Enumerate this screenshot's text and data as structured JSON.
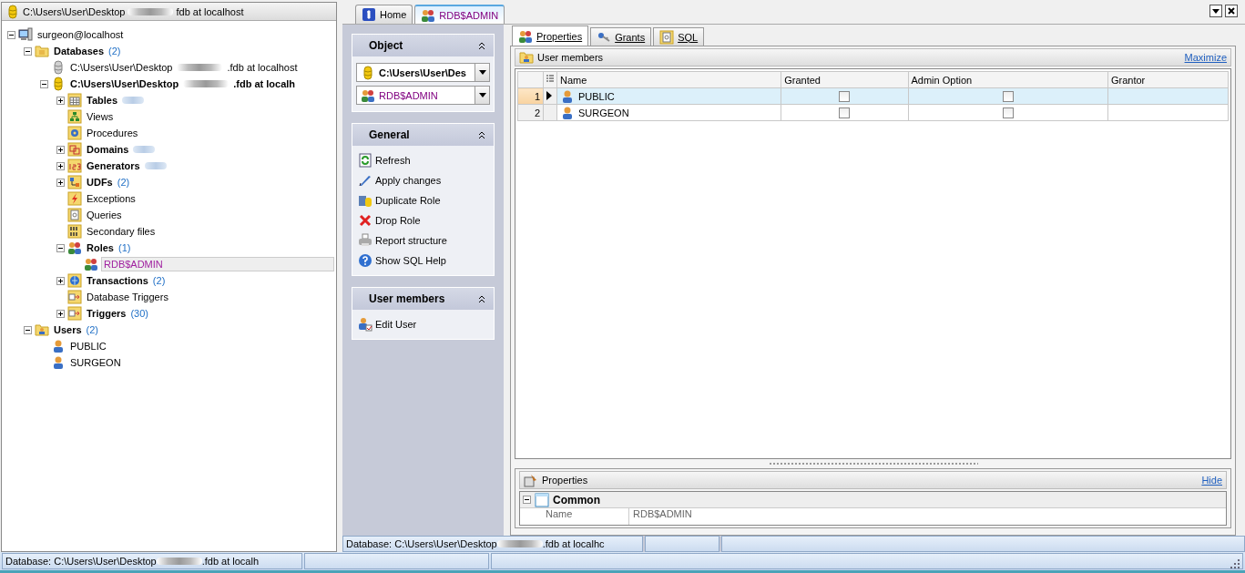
{
  "left_panel": {
    "header": {
      "path_start": "C:\\Users\\User\\Desktop",
      "path_end": "fdb at localhost",
      "redacted": true
    },
    "tree": [
      {
        "label": "surgeon@localhost",
        "kind": "server",
        "bold": false,
        "expanded": true,
        "selected": false,
        "children": [
          {
            "label": "Databases",
            "count": "(2)",
            "kind": "folder",
            "bold": true,
            "expanded": true,
            "selected": false,
            "children": [
              {
                "label": "C:\\Users\\User\\Desktop",
                "label_end": ".fdb at localhost",
                "redacted": true,
                "kind": "db-grey",
                "bold": false,
                "selected": false
              },
              {
                "label": "C:\\Users\\User\\Desktop",
                "label_end": ".fdb at localh",
                "redacted": true,
                "kind": "db",
                "bold": true,
                "expanded": true,
                "selected": false,
                "children": [
                  {
                    "label": "Tables",
                    "count_redacted": true,
                    "kind": "table",
                    "bold": true,
                    "expanded": false,
                    "selected": false
                  },
                  {
                    "label": "Views",
                    "kind": "view",
                    "bold": false,
                    "selected": false
                  },
                  {
                    "label": "Procedures",
                    "kind": "gear",
                    "bold": false,
                    "selected": false
                  },
                  {
                    "label": "Domains",
                    "count_redacted": true,
                    "kind": "domain",
                    "bold": true,
                    "expanded": false,
                    "selected": false
                  },
                  {
                    "label": "Generators",
                    "count_redacted": true,
                    "kind": "numbers",
                    "bold": true,
                    "expanded": false,
                    "selected": false
                  },
                  {
                    "label": "UDFs",
                    "count": "(2)",
                    "kind": "udf",
                    "bold": true,
                    "expanded": false,
                    "selected": false
                  },
                  {
                    "label": "Exceptions",
                    "kind": "bolt",
                    "bold": false,
                    "selected": false
                  },
                  {
                    "label": "Queries",
                    "kind": "query",
                    "bold": false,
                    "selected": false
                  },
                  {
                    "label": "Secondary files",
                    "kind": "files",
                    "bold": false,
                    "selected": false
                  },
                  {
                    "label": "Roles",
                    "count": "(1)",
                    "kind": "role",
                    "bold": true,
                    "expanded": true,
                    "selected": false,
                    "children": [
                      {
                        "label": "RDB$ADMIN",
                        "kind": "role-plain",
                        "bold": false,
                        "selected": true
                      }
                    ]
                  },
                  {
                    "label": "Transactions",
                    "count": "(2)",
                    "kind": "globe",
                    "bold": true,
                    "expanded": false,
                    "selected": false
                  },
                  {
                    "label": "Database Triggers",
                    "kind": "trigger",
                    "bold": false,
                    "selected": false
                  },
                  {
                    "label": "Triggers",
                    "count": "(30)",
                    "kind": "trigger",
                    "bold": true,
                    "expanded": false,
                    "selected": false
                  }
                ]
              }
            ]
          },
          {
            "label": "Users",
            "count": "(2)",
            "kind": "user-folder",
            "bold": true,
            "expanded": true,
            "selected": false,
            "children": [
              {
                "label": "PUBLIC",
                "kind": "user",
                "bold": false,
                "selected": false
              },
              {
                "label": "SURGEON",
                "kind": "user",
                "bold": false,
                "selected": false
              }
            ]
          }
        ]
      }
    ],
    "status": {
      "path_start": "Database: C:\\Users\\User\\Desktop",
      "path_end": ".fdb at localh",
      "redacted": true
    }
  },
  "doc_tabs": [
    {
      "label": "Home",
      "kind": "home",
      "selected": false
    },
    {
      "label": "RDB$ADMIN",
      "kind": "role",
      "selected": true
    }
  ],
  "nav_sections": [
    {
      "title": "Object",
      "expanded": true,
      "kind": "selectors",
      "selectors": [
        {
          "value": "C:\\Users\\User\\Des",
          "kind": "db",
          "bold": true
        },
        {
          "value": "RDB$ADMIN",
          "kind": "role",
          "bold": false
        }
      ]
    },
    {
      "title": "General",
      "expanded": true,
      "kind": "actions",
      "actions": [
        {
          "label": "Refresh",
          "kind": "refresh"
        },
        {
          "label": "Apply changes",
          "kind": "pen"
        },
        {
          "label": "Duplicate Role",
          "kind": "duplicate"
        },
        {
          "label": "Drop Role",
          "kind": "cross"
        },
        {
          "label": "Report structure",
          "kind": "printer"
        },
        {
          "label": "Show SQL Help",
          "kind": "help"
        }
      ]
    },
    {
      "title": "User members",
      "expanded": true,
      "kind": "actions",
      "actions": [
        {
          "label": "Edit User",
          "kind": "edit-user"
        }
      ]
    }
  ],
  "editor_tabs": [
    {
      "label": "Properties",
      "kind": "role",
      "selected": true
    },
    {
      "label": "Grants",
      "kind": "keys",
      "selected": false
    },
    {
      "label": "SQL",
      "kind": "query",
      "selected": false
    }
  ],
  "members_panel": {
    "title": "User members",
    "link": "Maximize",
    "columns": [
      "Name",
      "Granted",
      "Admin Option",
      "Grantor"
    ],
    "rows": [
      {
        "number": "1",
        "name": "PUBLIC",
        "granted": false,
        "admin_option": false,
        "selected": true
      },
      {
        "number": "2",
        "name": "SURGEON",
        "granted": false,
        "admin_option": false,
        "selected": false
      }
    ]
  },
  "properties_panel": {
    "title": "Properties",
    "link": "Hide",
    "category": "Common",
    "expanded": true,
    "properties": [
      {
        "name": "Name",
        "value": "RDB$ADMIN"
      }
    ]
  },
  "editor_status": {
    "path_start": "Database: C:\\Users\\User\\Desktop",
    "path_end": ".fdb at localhc",
    "redacted": true
  }
}
